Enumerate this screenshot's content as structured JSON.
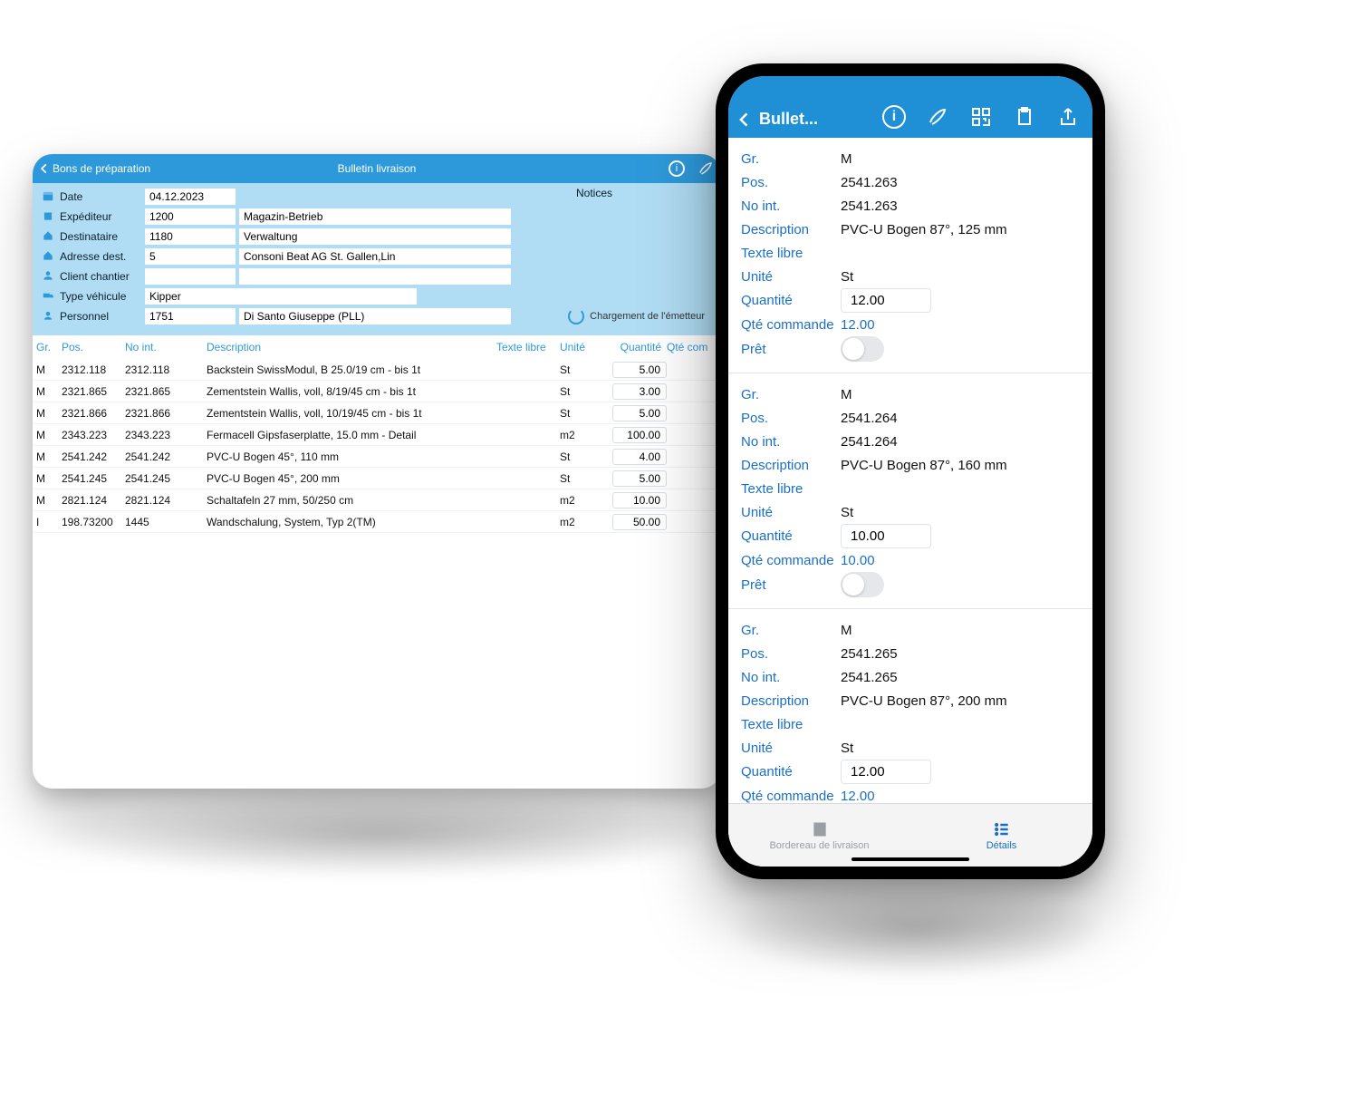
{
  "tablet": {
    "back_label": "Bons de préparation",
    "title": "Bulletin livraison",
    "notices_label": "Notices",
    "form": {
      "date_label": "Date",
      "date_value": "04.12.2023",
      "exp_label": "Expéditeur",
      "exp_code": "1200",
      "exp_name": "Magazin-Betrieb",
      "dest_label": "Destinataire",
      "dest_code": "1180",
      "dest_name": "Verwaltung",
      "addr_label": "Adresse dest.",
      "addr_code": "5",
      "addr_name": "Consoni Beat AG St. Gallen,Lin",
      "client_label": "Client chantier",
      "client_value": "",
      "veh_label": "Type véhicule",
      "veh_value": "Kipper",
      "pers_label": "Personnel",
      "pers_code": "1751",
      "pers_name": "Di Santo Giuseppe (PLL)",
      "loading_label": "Chargement de l'émetteur"
    },
    "columns": {
      "gr": "Gr.",
      "pos": "Pos.",
      "noint": "No int.",
      "desc": "Description",
      "texte": "Texte libre",
      "unite": "Unité",
      "quantite": "Quantité",
      "qtecom": "Qté com"
    },
    "rows": [
      {
        "gr": "M",
        "pos": "2312.118",
        "noint": "2312.118",
        "desc": "Backstein SwissModul, B 25.0/19 cm - bis 1t",
        "texte": "",
        "unite": "St",
        "q": "5.00"
      },
      {
        "gr": "M",
        "pos": "2321.865",
        "noint": "2321.865",
        "desc": "Zementstein Wallis, voll,   8/19/45 cm - bis 1t",
        "texte": "",
        "unite": "St",
        "q": "3.00"
      },
      {
        "gr": "M",
        "pos": "2321.866",
        "noint": "2321.866",
        "desc": "Zementstein Wallis, voll, 10/19/45 cm - bis 1t",
        "texte": "",
        "unite": "St",
        "q": "5.00"
      },
      {
        "gr": "M",
        "pos": "2343.223",
        "noint": "2343.223",
        "desc": "Fermacell Gipsfaserplatte, 15.0 mm - Detail",
        "texte": "",
        "unite": "m2",
        "q": "100.00"
      },
      {
        "gr": "M",
        "pos": "2541.242",
        "noint": "2541.242",
        "desc": "PVC-U Bogen 45°, 110 mm",
        "texte": "",
        "unite": "St",
        "q": "4.00"
      },
      {
        "gr": "M",
        "pos": "2541.245",
        "noint": "2541.245",
        "desc": "PVC-U Bogen 45°, 200 mm",
        "texte": "",
        "unite": "St",
        "q": "5.00"
      },
      {
        "gr": "M",
        "pos": "2821.124",
        "noint": "2821.124",
        "desc": "Schaltafeln 27 mm, 50/250 cm",
        "texte": "",
        "unite": "m2",
        "q": "10.00"
      },
      {
        "gr": "I",
        "pos": "198.73200",
        "noint": "1445",
        "desc": "Wandschalung, System, Typ 2(TM)",
        "texte": "",
        "unite": "m2",
        "q": "50.00"
      }
    ]
  },
  "phone": {
    "title": "Bullet...",
    "labels": {
      "gr": "Gr.",
      "pos": "Pos.",
      "noint": "No int.",
      "desc": "Description",
      "texte": "Texte libre",
      "unite": "Unité",
      "quantite": "Quantité",
      "qtecom": "Qté commande",
      "pret": "Prêt"
    },
    "items": [
      {
        "gr": "M",
        "pos": "2541.263",
        "noint": "2541.263",
        "desc": "PVC-U Bogen 87°, 125 mm",
        "unite": "St",
        "q": "12.00",
        "qc": "12.00"
      },
      {
        "gr": "M",
        "pos": "2541.264",
        "noint": "2541.264",
        "desc": "PVC-U Bogen 87°, 160 mm",
        "unite": "St",
        "q": "10.00",
        "qc": "10.00"
      },
      {
        "gr": "M",
        "pos": "2541.265",
        "noint": "2541.265",
        "desc": "PVC-U Bogen 87°, 200 mm",
        "unite": "St",
        "q": "12.00",
        "qc": "12.00"
      }
    ],
    "tabs": {
      "left": "Bordereau de livraison",
      "right": "Détails"
    }
  }
}
